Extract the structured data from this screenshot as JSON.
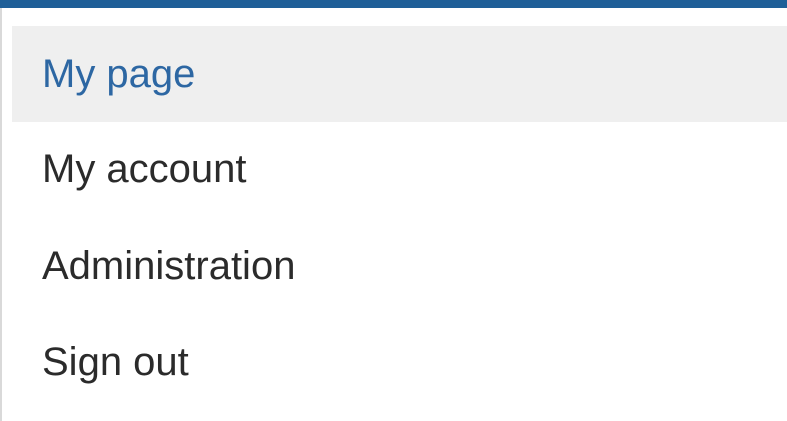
{
  "menu": {
    "items": [
      {
        "label": "My page",
        "state": "active"
      },
      {
        "label": "My account",
        "state": "normal"
      },
      {
        "label": "Administration",
        "state": "normal"
      },
      {
        "label": "Sign out",
        "state": "normal"
      }
    ]
  },
  "colors": {
    "accent": "#1f5f98",
    "active_text": "#2d67a3",
    "active_background": "#efefef",
    "text": "#2b2b2b",
    "divider": "#d9d9d9"
  }
}
